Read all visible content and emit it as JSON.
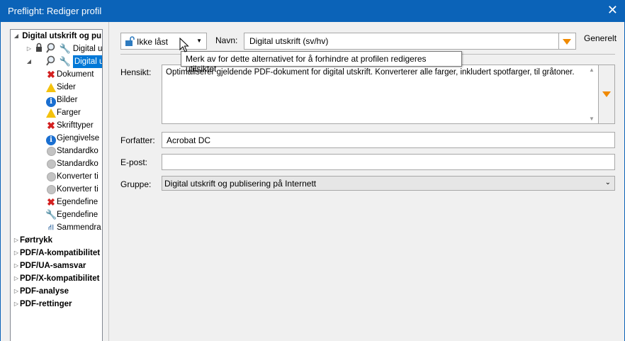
{
  "window": {
    "title": "Preflight: Rediger profil",
    "close_icon": "close-icon"
  },
  "tree": {
    "root": {
      "label": "Digital utskrift og pu",
      "expanded": true
    },
    "profiles": [
      {
        "label": "Digital utsk",
        "expanded": false,
        "locked": true,
        "selected": false
      },
      {
        "label": "Digital utsk",
        "expanded": true,
        "locked": false,
        "selected": true
      }
    ],
    "children": [
      {
        "label": "Dokument",
        "icon": "error-icon"
      },
      {
        "label": "Sider",
        "icon": "warning-icon"
      },
      {
        "label": "Bilder",
        "icon": "info-icon"
      },
      {
        "label": "Farger",
        "icon": "warning-icon"
      },
      {
        "label": "Skrifttyper",
        "icon": "error-icon"
      },
      {
        "label": "Gjengivelse",
        "icon": "info-icon"
      },
      {
        "label": "Standardko",
        "icon": "disabled-circle-icon"
      },
      {
        "label": "Standardko",
        "icon": "disabled-circle-icon"
      },
      {
        "label": "Konverter ti",
        "icon": "disabled-circle-icon"
      },
      {
        "label": "Konverter ti",
        "icon": "disabled-circle-icon"
      },
      {
        "label": "Egendefine",
        "icon": "error-icon"
      },
      {
        "label": "Egendefine",
        "icon": "wrench-icon"
      },
      {
        "label": "Sammendra",
        "icon": "summary-icon"
      }
    ],
    "groups": [
      "Førtrykk",
      "PDF/A-kompatibilitet",
      "PDF/UA-samsvar",
      "PDF/X-kompatibilitet",
      "PDF-analyse",
      "PDF-rettinger"
    ]
  },
  "toolbar": {
    "lock_label": "Ikke låst",
    "name_label": "Navn:",
    "name_value": "Digital utskrift (sv/hv)",
    "section_label": "Generelt"
  },
  "tooltip": {
    "text": "Merk av for dette alternativet for å forhindre at profilen redigeres utilsiktet"
  },
  "form": {
    "purpose_label": "Hensikt:",
    "purpose_value": "Optimaliserer gjeldende PDF-dokument for digital utskrift. Konverterer alle farger, inkludert spotfarger, til gråtoner.",
    "author_label": "Forfatter:",
    "author_value": "Acrobat DC",
    "email_label": "E-post:",
    "email_value": "",
    "group_label": "Gruppe:",
    "group_value": "Digital utskrift og publisering på Internett"
  },
  "colors": {
    "titlebar": "#0b63b8",
    "selection": "#0078d7",
    "dropdown_arrow": "#f08a00",
    "error": "#d32020",
    "warning": "#f4c20d",
    "info": "#1a6fd1"
  }
}
